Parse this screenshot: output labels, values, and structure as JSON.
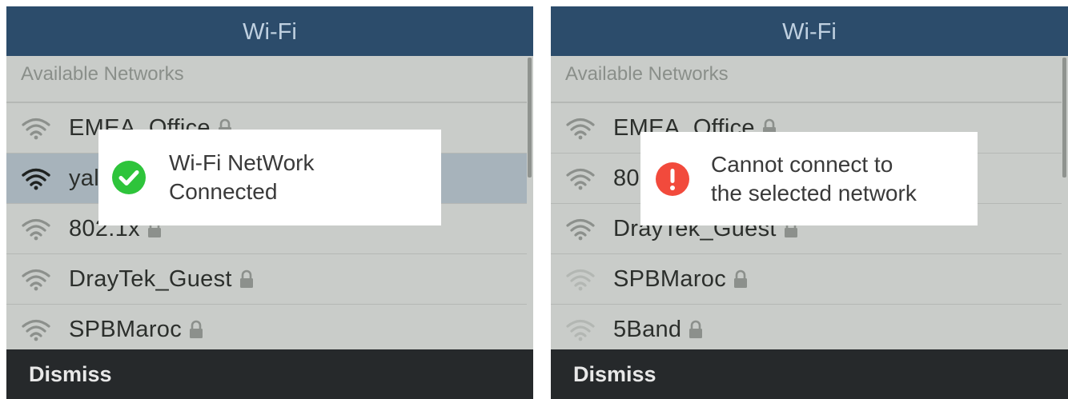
{
  "colors": {
    "title_bar": "#2c4c6b",
    "list_background": "#c9ccc9",
    "selected_row": "#a7b3bb",
    "bottom_bar": "#26292b",
    "success": "#2ec43b",
    "error": "#f24a3c"
  },
  "left_screen": {
    "title": "Wi-Fi",
    "section_header": "Available Networks",
    "networks": [
      {
        "name": "EMEA_Office",
        "icon": "wifi-icon",
        "locked": true
      },
      {
        "name": "yal",
        "icon": "wifi-icon",
        "locked": false,
        "selected": true
      },
      {
        "name": "802.1x",
        "icon": "wifi-icon",
        "locked": true
      },
      {
        "name": "DrayTek_Guest",
        "icon": "wifi-icon",
        "locked": true
      },
      {
        "name": "SPBMaroc",
        "icon": "wifi-icon",
        "locked": true
      }
    ],
    "toast": {
      "icon": "check-circle-icon",
      "line1": "Wi-Fi NetWork",
      "line2": "Connected"
    },
    "softkey": "Dismiss"
  },
  "right_screen": {
    "title": "Wi-Fi",
    "section_header": "Available Networks",
    "networks": [
      {
        "name": "EMEA_Office",
        "icon": "wifi-icon",
        "locked": true
      },
      {
        "name": "80",
        "icon": "wifi-icon",
        "locked": false
      },
      {
        "name": "DrayTek_Guest",
        "icon": "wifi-icon",
        "locked": true
      },
      {
        "name": "SPBMaroc",
        "icon": "wifi-icon",
        "locked": true
      },
      {
        "name": "5Band",
        "icon": "wifi-icon",
        "locked": true
      }
    ],
    "toast": {
      "icon": "error-circle-icon",
      "line1": "Cannot connect to",
      "line2": "the selected network"
    },
    "softkey": "Dismiss"
  }
}
